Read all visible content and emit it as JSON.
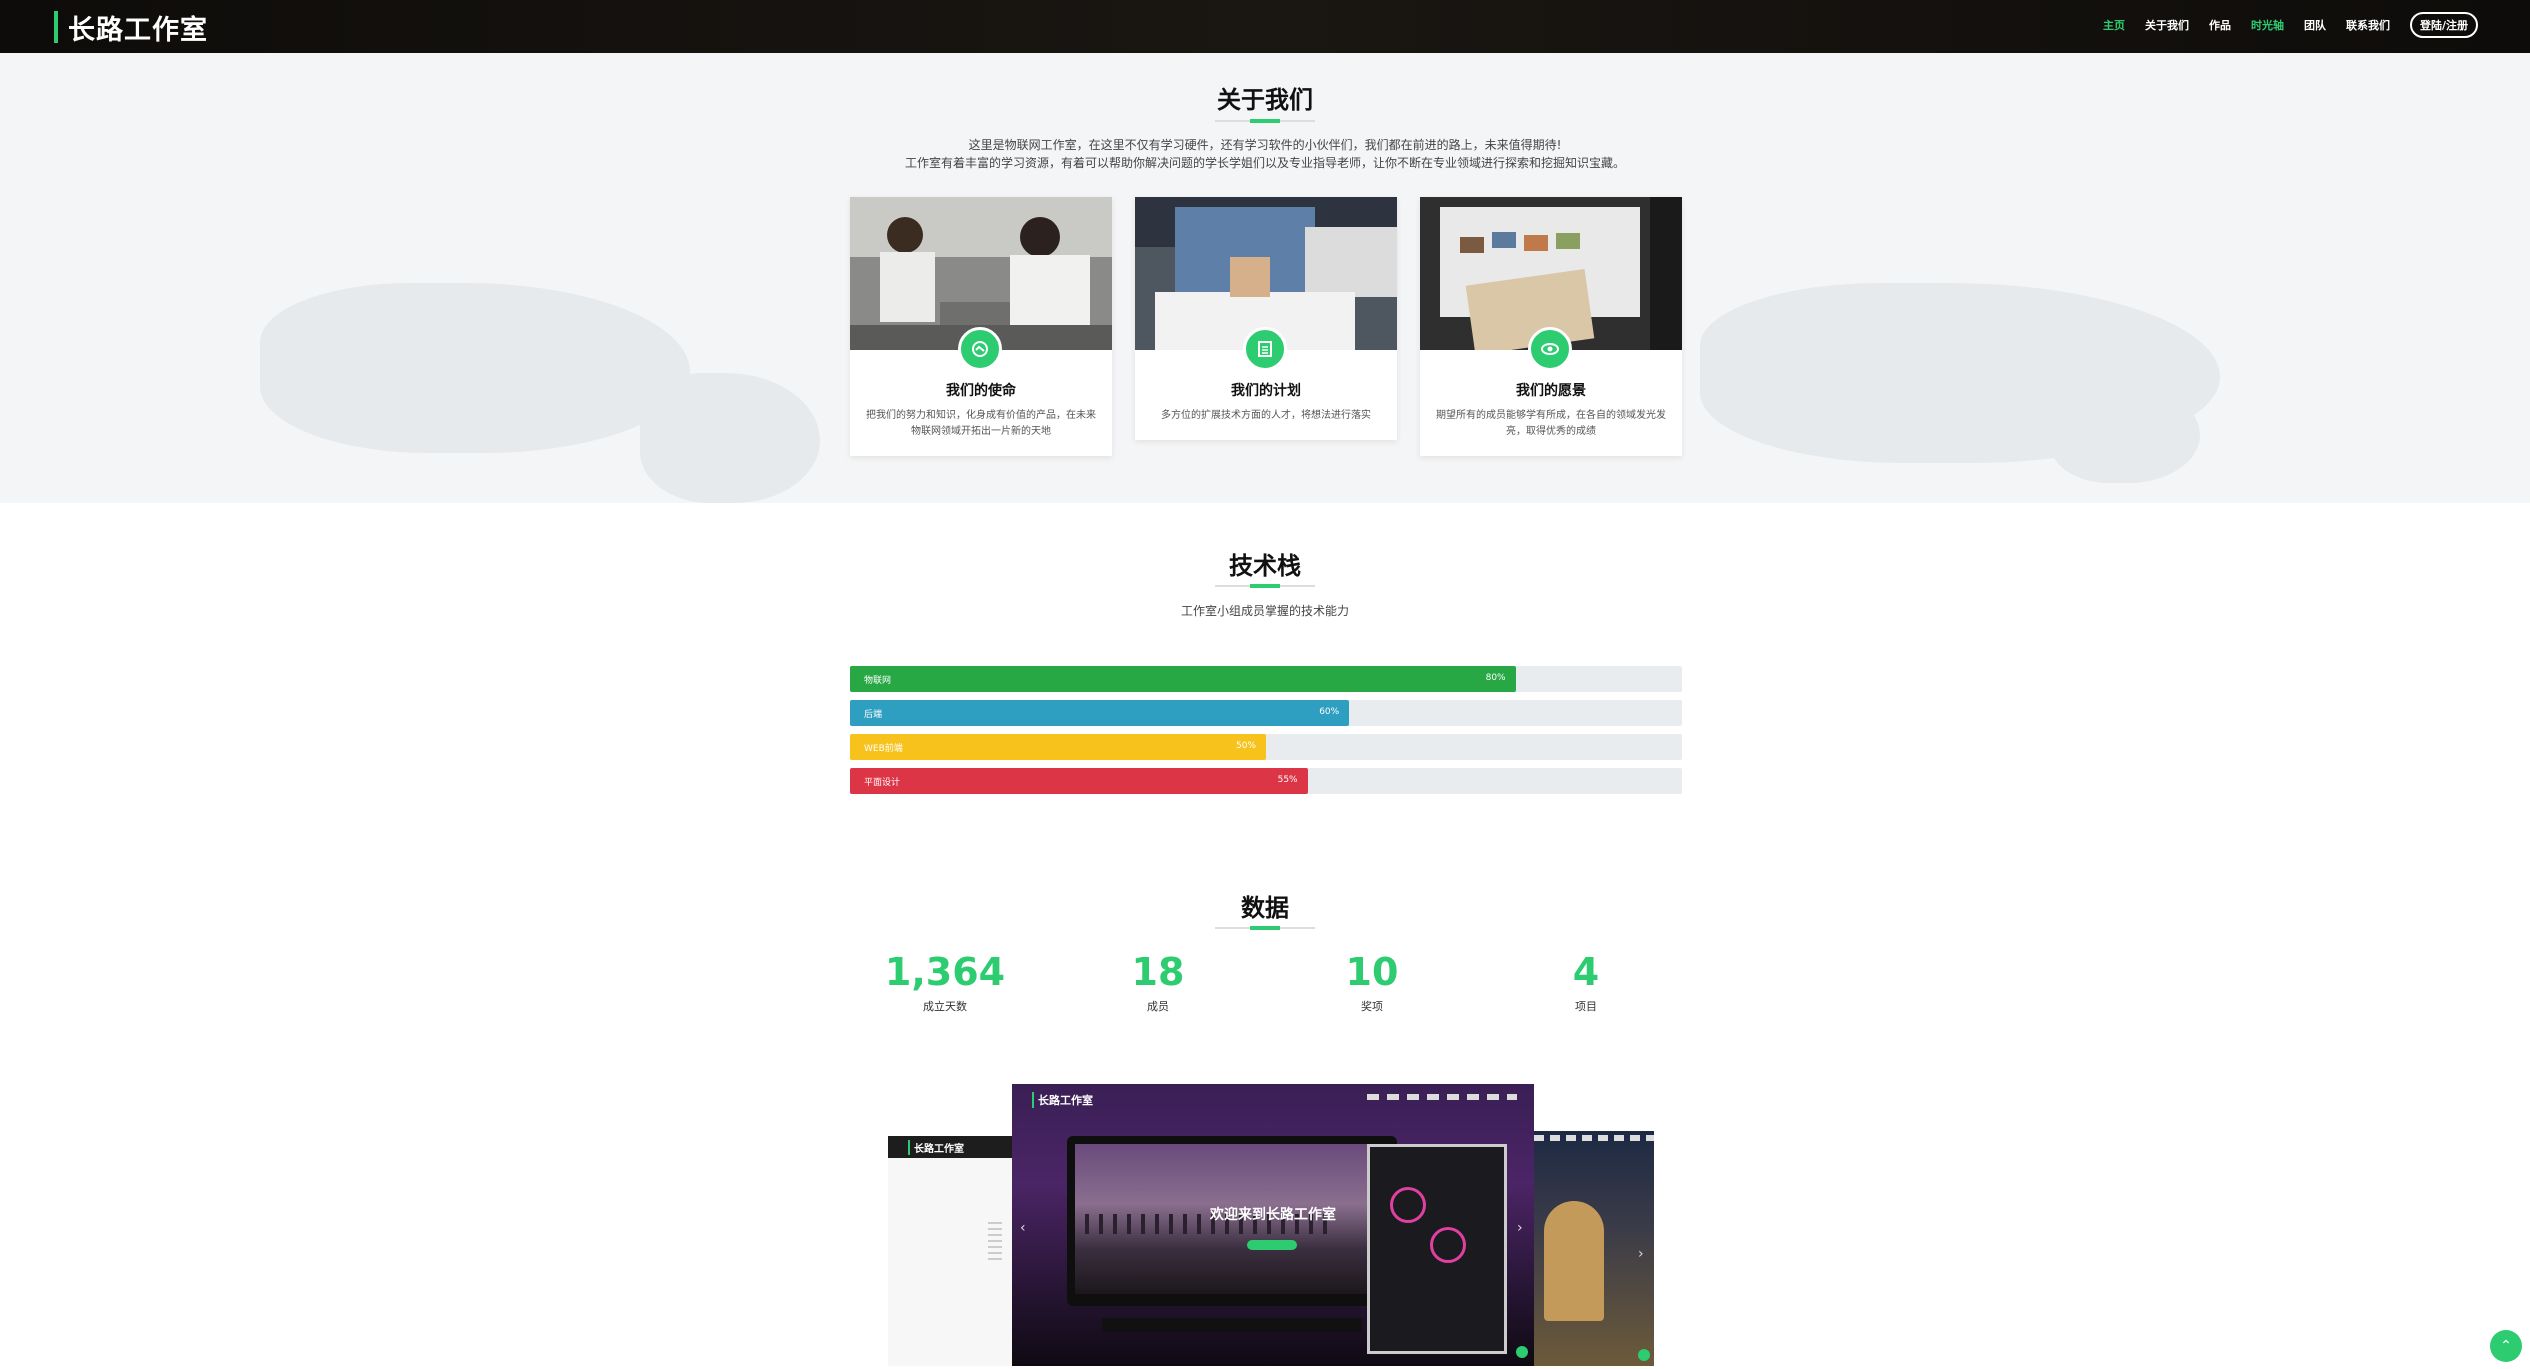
{
  "header": {
    "brand": "长路工作室",
    "nav": [
      "主页",
      "关于我们",
      "作品",
      "时光轴",
      "团队",
      "联系我们"
    ],
    "login": "登陆/注册"
  },
  "about": {
    "title": "关于我们",
    "desc1": "这里是物联网工作室，在这里不仅有学习硬件，还有学习软件的小伙伴们，我们都在前进的路上，未来值得期待!",
    "desc2": "工作室有着丰富的学习资源，有着可以帮助你解决问题的学长学姐们以及专业指导老师，让你不断在专业领域进行探索和挖掘知识宝藏。",
    "cards": [
      {
        "title": "我们的使命",
        "text": "把我们的努力和知识，化身成有价值的产品，在未来物联网领域开拓出一片新的天地",
        "icon": "handshake-icon"
      },
      {
        "title": "我们的计划",
        "text": "多方位的扩展技术方面的人才，将想法进行落实",
        "icon": "list-icon"
      },
      {
        "title": "我们的愿景",
        "text": "期望所有的成员能够学有所成，在各自的领域发光发亮，取得优秀的成绩",
        "icon": "eye-icon"
      }
    ]
  },
  "skills": {
    "title": "技术栈",
    "subtitle": "工作室小组成员掌握的技术能力",
    "items": [
      {
        "name": "物联网",
        "percent": 80,
        "label": "80%",
        "color": "#28a745"
      },
      {
        "name": "后端",
        "percent": 60,
        "label": "60%",
        "color": "#2e9fc0"
      },
      {
        "name": "WEB前端",
        "percent": 50,
        "label": "50%",
        "color": "#f7c21c"
      },
      {
        "name": "平面设计",
        "percent": 55,
        "label": "55%",
        "color": "#dc3545"
      }
    ]
  },
  "stats": {
    "title": "数据",
    "items": [
      {
        "num": "1,364",
        "label": "成立天数"
      },
      {
        "num": "18",
        "label": "成员"
      },
      {
        "num": "10",
        "label": "奖项"
      },
      {
        "num": "4",
        "label": "项目"
      }
    ]
  },
  "showcase": {
    "brand": "长路工作室",
    "welcome": "欢迎来到长路工作室"
  },
  "colors": {
    "accent": "#2ecc71"
  }
}
